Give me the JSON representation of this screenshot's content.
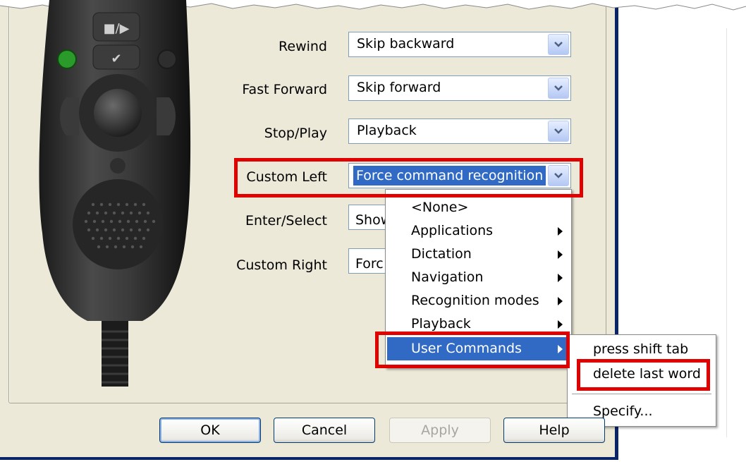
{
  "rows": [
    {
      "label": "Rewind",
      "value": "Skip backward"
    },
    {
      "label": "Fast Forward",
      "value": "Skip forward"
    },
    {
      "label": "Stop/Play",
      "value": "Playback"
    },
    {
      "label": "Custom Left",
      "value": "Force command recognition"
    },
    {
      "label": "Enter/Select",
      "value": "Show"
    },
    {
      "label": "Custom Right",
      "value": "Forc"
    }
  ],
  "menu": {
    "items": [
      {
        "label": "<None>",
        "submenu": false
      },
      {
        "label": "Applications",
        "submenu": true
      },
      {
        "label": "Dictation",
        "submenu": true
      },
      {
        "label": "Navigation",
        "submenu": true
      },
      {
        "label": "Recognition modes",
        "submenu": true
      },
      {
        "label": "Playback",
        "submenu": true
      },
      {
        "label": "User Commands",
        "submenu": true
      }
    ]
  },
  "submenu": {
    "items": [
      "press shift tab",
      "delete last word"
    ],
    "specify": "Specify..."
  },
  "buttons": {
    "ok": "OK",
    "cancel": "Cancel",
    "apply": "Apply",
    "help": "Help"
  },
  "device": {
    "top_button_label": "■/▶",
    "check_label": "✔"
  },
  "colors": {
    "highlight": "#e10000",
    "selection": "#316ac5",
    "dialog_bg": "#ece9d8",
    "led": "#2a9a2a"
  }
}
